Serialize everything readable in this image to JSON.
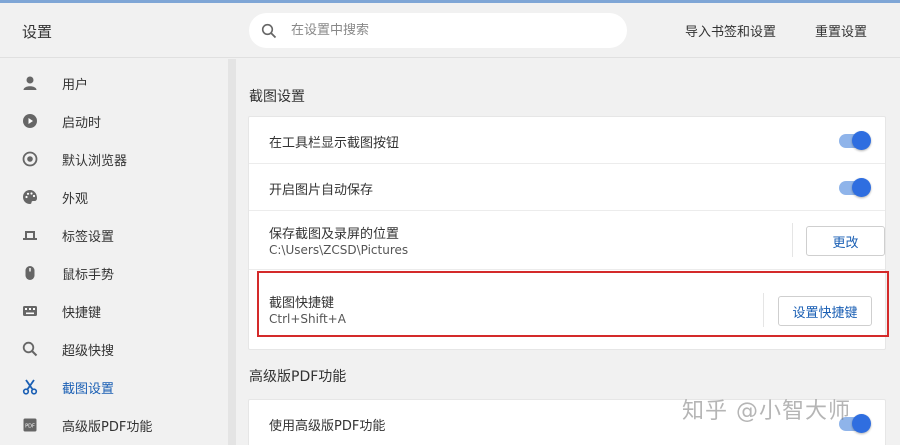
{
  "header": {
    "title": "设置",
    "search_placeholder": "在设置中搜索",
    "import_label": "导入书签和设置",
    "reset_label": "重置设置"
  },
  "sidebar": {
    "items": [
      {
        "label": "用户",
        "icon": "user-icon"
      },
      {
        "label": "启动时",
        "icon": "power-icon"
      },
      {
        "label": "默认浏览器",
        "icon": "browser-icon"
      },
      {
        "label": "外观",
        "icon": "palette-icon"
      },
      {
        "label": "标签设置",
        "icon": "tab-icon"
      },
      {
        "label": "鼠标手势",
        "icon": "mouse-icon"
      },
      {
        "label": "快捷键",
        "icon": "keyboard-icon"
      },
      {
        "label": "超级快搜",
        "icon": "search-icon"
      },
      {
        "label": "截图设置",
        "icon": "scissors-icon",
        "active": true
      },
      {
        "label": "高级版PDF功能",
        "icon": "pdf-icon"
      }
    ]
  },
  "screenshot_section": {
    "title": "截图设置",
    "show_button_label": "在工具栏显示截图按钮",
    "show_button_on": true,
    "autosave_label": "开启图片自动保存",
    "autosave_on": true,
    "save_location_label": "保存截图及录屏的位置",
    "save_location_path": "C:\\Users\\ZCSD\\Pictures",
    "change_button": "更改",
    "shortcut_label": "截图快捷键",
    "shortcut_value": "Ctrl+Shift+A",
    "shortcut_button": "设置快捷键"
  },
  "pdf_section": {
    "title": "高级版PDF功能",
    "use_pdf_label": "使用高级版PDF功能",
    "use_pdf_on": true
  },
  "watermark": "知乎 @小智大师",
  "colors": {
    "accent": "#2f6ee0",
    "highlight": "#d42a2a",
    "active_text": "#1a5fb4"
  }
}
